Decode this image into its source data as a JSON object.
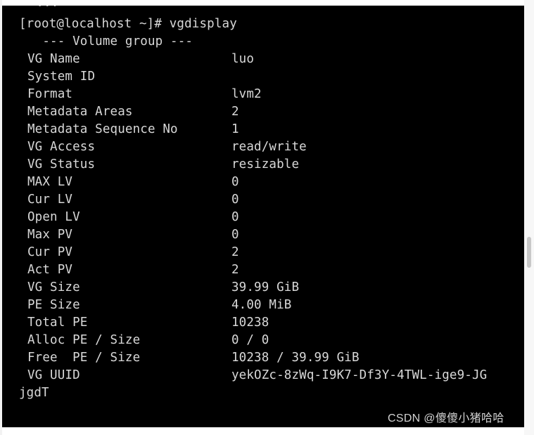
{
  "terminal": {
    "clipped_top_line": "  ... ",
    "prompt_line": "[root@localhost ~]# vgdisplay",
    "header_line": "  --- Volume group ---",
    "rows": [
      {
        "label": "VG Name",
        "value": "luo"
      },
      {
        "label": "System ID",
        "value": ""
      },
      {
        "label": "Format",
        "value": "lvm2"
      },
      {
        "label": "Metadata Areas",
        "value": "2"
      },
      {
        "label": "Metadata Sequence No",
        "value": "1"
      },
      {
        "label": "VG Access",
        "value": "read/write"
      },
      {
        "label": "VG Status",
        "value": "resizable"
      },
      {
        "label": "MAX LV",
        "value": "0"
      },
      {
        "label": "Cur LV",
        "value": "0"
      },
      {
        "label": "Open LV",
        "value": "0"
      },
      {
        "label": "Max PV",
        "value": "0"
      },
      {
        "label": "Cur PV",
        "value": "2"
      },
      {
        "label": "Act PV",
        "value": "2"
      },
      {
        "label": "VG Size",
        "value": "39.99 GiB"
      },
      {
        "label": "PE Size",
        "value": "4.00 MiB"
      },
      {
        "label": "Total PE",
        "value": "10238"
      },
      {
        "label": "Alloc PE / Size",
        "value": "0 / 0"
      },
      {
        "label": "Free  PE / Size",
        "value": "10238 / 39.99 GiB"
      },
      {
        "label": "VG UUID",
        "value": "yekOZc-8zWq-I9K7-Df3Y-4TWL-ige9-JG"
      }
    ],
    "uuid_wrap_line": "jgdT",
    "colors": {
      "background": "#000000",
      "foreground": "#d8d8d8"
    }
  },
  "watermark": {
    "text": "CSDN @傻傻小猪哈哈"
  }
}
